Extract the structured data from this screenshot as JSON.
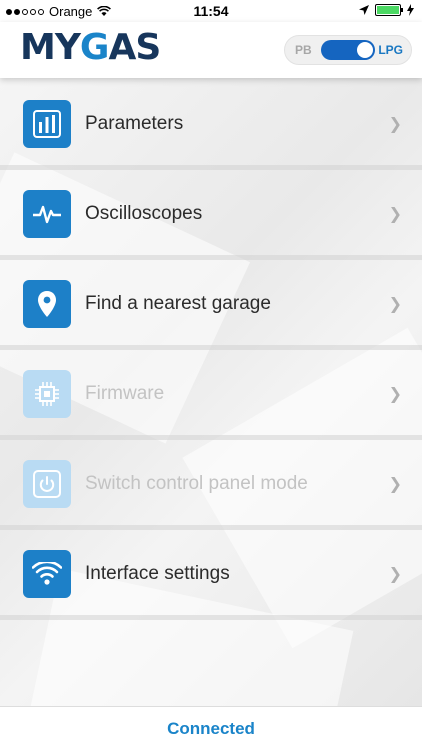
{
  "status_bar": {
    "carrier": "Orange",
    "time": "11:54",
    "signal_bars_filled": 2,
    "signal_bars_total": 5
  },
  "header": {
    "logo": {
      "part1": "MY",
      "part2": "G",
      "part3": "AS"
    },
    "fuel_toggle": {
      "left_label": "PB",
      "right_label": "LPG",
      "selected": "LPG"
    }
  },
  "menu": {
    "items": [
      {
        "label": "Parameters",
        "icon": "bar-chart-icon",
        "enabled": true
      },
      {
        "label": "Oscilloscopes",
        "icon": "pulse-wave-icon",
        "enabled": true
      },
      {
        "label": "Find a nearest garage",
        "icon": "map-pin-icon",
        "enabled": true
      },
      {
        "label": "Firmware",
        "icon": "chip-icon",
        "enabled": false
      },
      {
        "label": "Switch control panel mode",
        "icon": "power-icon",
        "enabled": false
      },
      {
        "label": "Interface settings",
        "icon": "wifi-icon",
        "enabled": true
      }
    ]
  },
  "footer": {
    "connection_status": "Connected"
  },
  "colors": {
    "accent": "#1a84c9",
    "logo_dark": "#17365c",
    "disabled_icon": "#b9dbf3",
    "toggle_on": "#1565c0"
  }
}
